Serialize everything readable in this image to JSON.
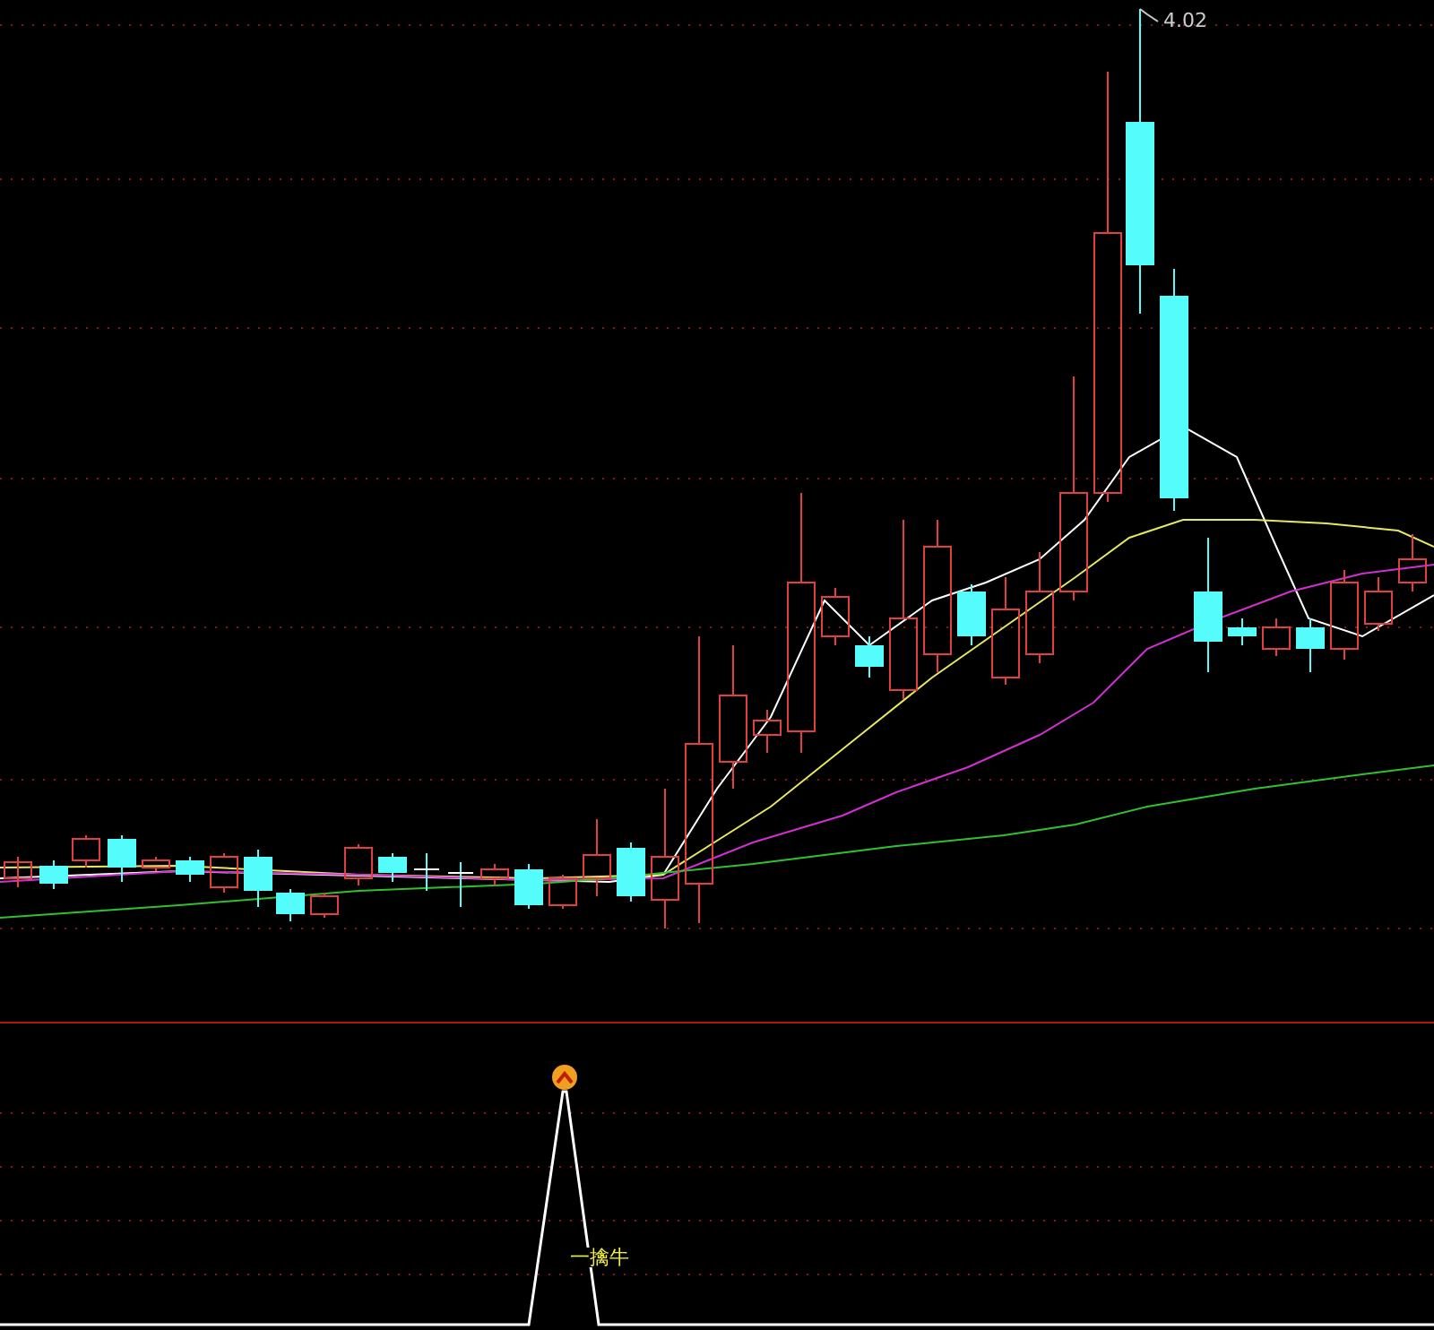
{
  "price_chart": {
    "high_label": "4.02"
  },
  "indicator": {
    "signal_label": "一擒牛"
  }
}
